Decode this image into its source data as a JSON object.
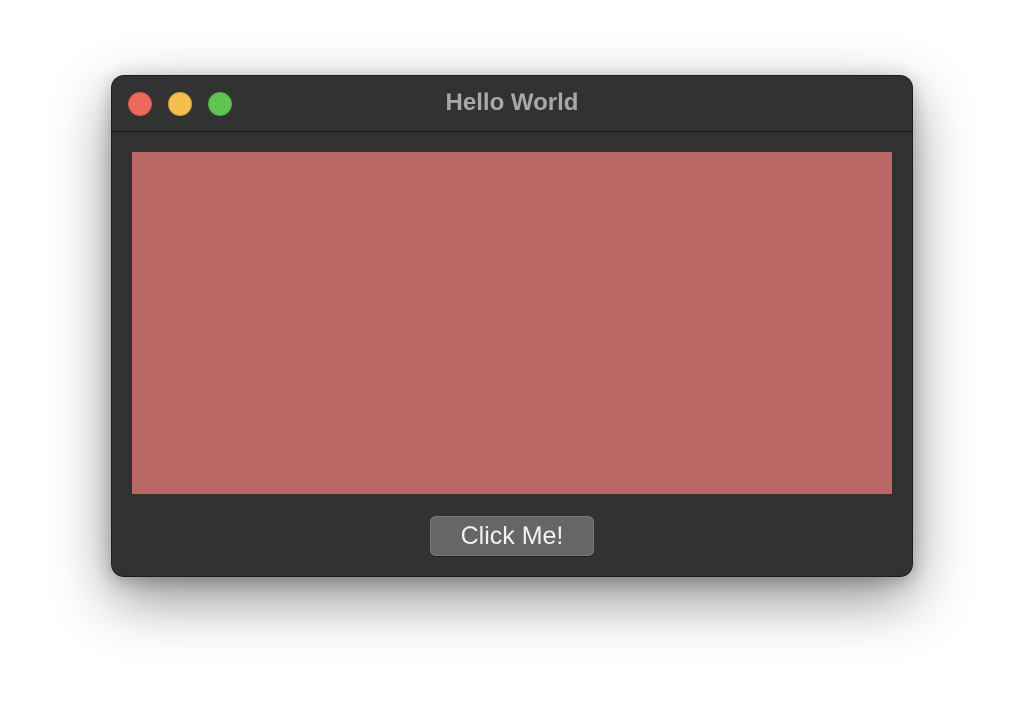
{
  "window": {
    "title": "Hello World",
    "controls": {
      "close_icon": "close-dot",
      "minimize_icon": "minimize-dot",
      "zoom_icon": "zoom-dot"
    }
  },
  "content": {
    "canvas_color": "#b96866",
    "button_label": "Click Me!"
  },
  "colors": {
    "window_bg": "#323232",
    "close": "#ec6a5e",
    "minimize": "#f4bf4f",
    "zoom": "#61c554",
    "button_bg": "#666666"
  }
}
